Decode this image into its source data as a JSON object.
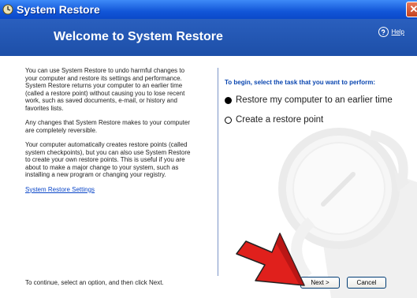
{
  "window": {
    "title": "System Restore",
    "close_glyph": "✕"
  },
  "header": {
    "title": "Welcome to System Restore",
    "help_label": "Help"
  },
  "left_pane": {
    "paragraph_1": "You can use System Restore to undo harmful changes to your computer and restore its settings and performance. System Restore returns your computer to an earlier time (called a restore point) without causing you to lose recent work, such as saved documents, e-mail, or history and favorites lists.",
    "paragraph_2": "Any changes that System Restore makes to your computer are completely reversible.",
    "paragraph_3": "Your computer automatically creates restore points (called system checkpoints), but you can also use System Restore to create your own restore points. This is useful if you are about to make a major change to your system, such as installing a new program or changing your registry.",
    "settings_link": "System Restore Settings"
  },
  "right_pane": {
    "prompt": "To begin, select the task that you want to perform:",
    "options": [
      {
        "label": "Restore my computer to an earlier time",
        "selected": true
      },
      {
        "label": "Create a restore point",
        "selected": false
      }
    ]
  },
  "footer": {
    "instruction": "To continue, select an option, and then click Next.",
    "next_label": "Next >",
    "cancel_label": "Cancel"
  },
  "colors": {
    "title_bar": "#1256d8",
    "header_band": "#2a5fbe",
    "link": "#0a46c8",
    "arrow": "#e0201c"
  },
  "icons": [
    "system-restore-app-icon",
    "close-icon",
    "help-icon",
    "clock-watermark-icon",
    "pointer-arrow-icon"
  ]
}
